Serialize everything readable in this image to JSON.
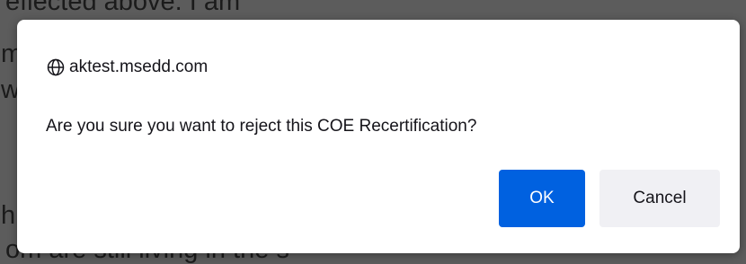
{
  "background": {
    "lines": [
      "eflected above. I am",
      "m",
      "w",
      "h",
      "om are still living in the s"
    ]
  },
  "dialog": {
    "origin": "aktest.msedd.com",
    "origin_icon": "globe-icon",
    "message": "Are you sure you want to reject this COE Recertification?",
    "ok_label": "OK",
    "cancel_label": "Cancel"
  },
  "colors": {
    "primary_button": "#0061e0",
    "secondary_button": "#f0f0f4",
    "backdrop": "#5c5c5c"
  }
}
